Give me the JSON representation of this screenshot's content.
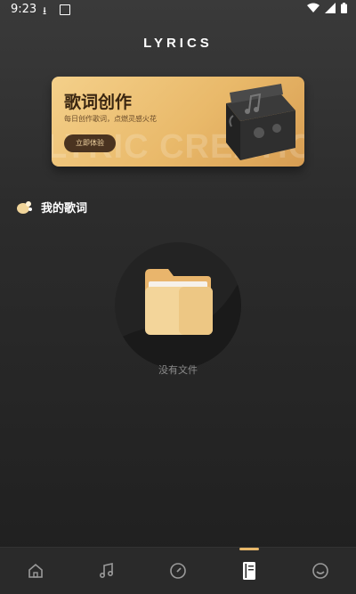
{
  "status": {
    "time": "9:23"
  },
  "app": {
    "title": "LYRICS"
  },
  "banner": {
    "title": "歌词创作",
    "subtitle": "每日创作歌词，点燃灵感火花",
    "cta": "立即体验",
    "watermark": "LYRIC CREATION"
  },
  "section": {
    "title": "我的歌词"
  },
  "empty": {
    "text": "没有文件"
  },
  "tabs": [
    {
      "icon": "home-icon"
    },
    {
      "icon": "music-note-icon"
    },
    {
      "icon": "compass-icon"
    },
    {
      "icon": "notebook-icon",
      "active": true
    },
    {
      "icon": "smile-icon"
    }
  ],
  "colors": {
    "accent": "#e8b86a",
    "banner_dark": "#4a3320"
  }
}
